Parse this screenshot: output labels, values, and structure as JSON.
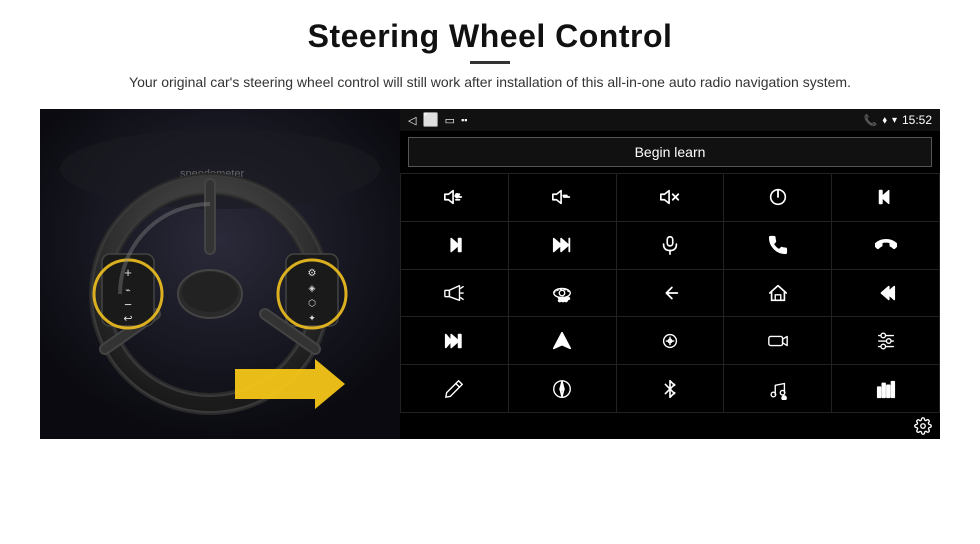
{
  "header": {
    "title": "Steering Wheel Control",
    "subtitle": "Your original car's steering wheel control will still work after installation of this all-in-one auto radio navigation system."
  },
  "android_panel": {
    "status_bar": {
      "back_icon": "◁",
      "home_icon": "⬜",
      "recent_icon": "▢",
      "signal_icon": "▪▪",
      "phone_icon": "📞",
      "location_icon": "◈",
      "wifi_icon": "▾",
      "time": "15:52"
    },
    "begin_learn_label": "Begin learn",
    "icons": [
      {
        "id": "vol-up",
        "label": "volume up"
      },
      {
        "id": "vol-down",
        "label": "volume down"
      },
      {
        "id": "vol-mute",
        "label": "volume mute"
      },
      {
        "id": "power",
        "label": "power"
      },
      {
        "id": "prev-track",
        "label": "previous track end"
      },
      {
        "id": "skip-fwd",
        "label": "skip forward"
      },
      {
        "id": "fast-fwd",
        "label": "fast forward"
      },
      {
        "id": "mic",
        "label": "microphone"
      },
      {
        "id": "phone",
        "label": "phone"
      },
      {
        "id": "hang-up",
        "label": "hang up"
      },
      {
        "id": "horn",
        "label": "horn"
      },
      {
        "id": "360-cam",
        "label": "360 camera"
      },
      {
        "id": "back",
        "label": "back"
      },
      {
        "id": "home",
        "label": "home"
      },
      {
        "id": "skip-back",
        "label": "skip to start"
      },
      {
        "id": "next-track",
        "label": "next track"
      },
      {
        "id": "navigate",
        "label": "navigate"
      },
      {
        "id": "eq",
        "label": "equalizer"
      },
      {
        "id": "dashcam",
        "label": "dash cam"
      },
      {
        "id": "tuner",
        "label": "tuner"
      },
      {
        "id": "pen",
        "label": "pen"
      },
      {
        "id": "compass",
        "label": "compass"
      },
      {
        "id": "bluetooth",
        "label": "bluetooth"
      },
      {
        "id": "music-settings",
        "label": "music settings"
      },
      {
        "id": "equalizer-bars",
        "label": "equalizer bars"
      }
    ],
    "settings_icon": "settings"
  }
}
